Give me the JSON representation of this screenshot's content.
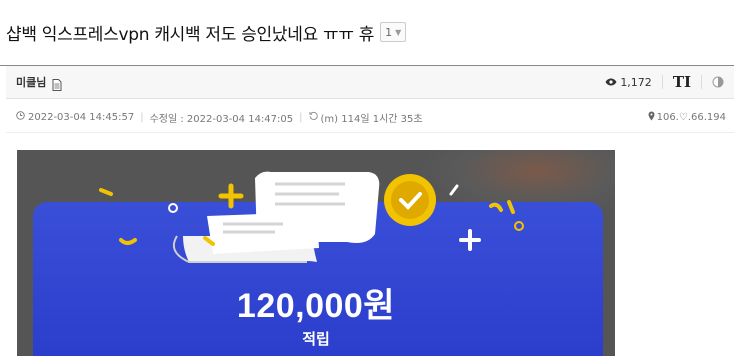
{
  "post": {
    "title": "샵백 익스프레스vpn 캐시백 저도 승인났네요 ㅠㅠ 휴",
    "comment_count": "1"
  },
  "meta": {
    "author": "미클님",
    "views": "1,172",
    "font_size_button": "TI"
  },
  "info": {
    "created": "2022-03-04 14:45:57",
    "modified": "수정일 : 2022-03-04 14:47:05",
    "elapsed": "(m) 114일 1시간 35초",
    "ip": "106.♡.66.194"
  },
  "image": {
    "amount": "120,000원",
    "label": "적립"
  },
  "colors": {
    "card_blue": "#3346d3",
    "coin_gold": "#f2c300"
  }
}
